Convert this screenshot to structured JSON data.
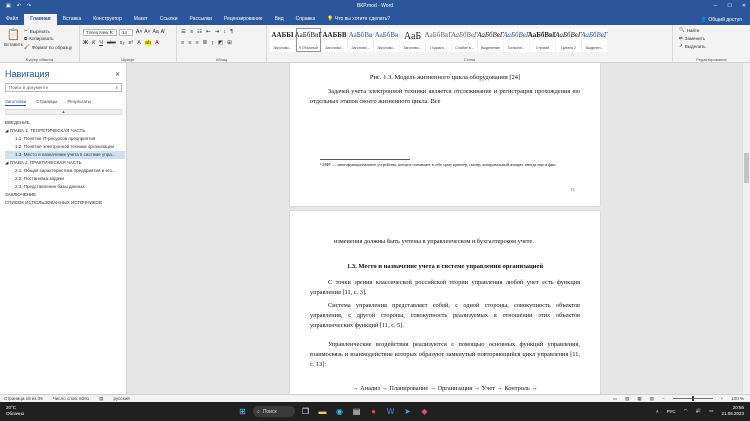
{
  "title_bar": {
    "doc_title": "ВКР.mod - Word",
    "search_hint": "Что вы хотите сделать?"
  },
  "tabs": [
    "Файл",
    "Главная",
    "Вставка",
    "Конструктор",
    "Макет",
    "Ссылки",
    "Рассылки",
    "Рецензирование",
    "Вид",
    "Справка"
  ],
  "share_label": "Общий доступ",
  "ribbon": {
    "paste": "Вставить",
    "cut": "Вырезать",
    "copy": "Копировать",
    "format_painter": "Формат по образцу",
    "clipboard_group": "Буфер обмена",
    "font_name": "Times New R",
    "font_size": "14",
    "font_group": "Шрифт",
    "paragraph_group": "Абзац",
    "styles_group": "Стили",
    "find": "Найти",
    "replace": "Заменить",
    "select": "Выделить",
    "editing_group": "Редактирование",
    "styles": [
      {
        "preview": "ААББІ",
        "name": "Заголово..."
      },
      {
        "preview": "АаБбВвГ",
        "name": "¶ Обычный"
      },
      {
        "preview": "ААББВ",
        "name": "Заголово..."
      },
      {
        "preview": "АаБбВв",
        "name": "Заголово..."
      },
      {
        "preview": "АаБбВв",
        "name": "Заголово..."
      },
      {
        "preview": "АаБ",
        "name": "Заголово..."
      },
      {
        "preview": "АаБбВвГ",
        "name": "Подзаго..."
      },
      {
        "preview": "АаБбВвГ",
        "name": "Слабое в..."
      },
      {
        "preview": "АаБбВвГ",
        "name": "Выделение"
      },
      {
        "preview": "АаБбВвГ",
        "name": "Сильное..."
      },
      {
        "preview": "АаБбВвГ",
        "name": "Строгий"
      },
      {
        "preview": "АаБбВвГ",
        "name": "Цитата 2"
      },
      {
        "preview": "АаБбВвГ",
        "name": "Выделен..."
      }
    ]
  },
  "nav": {
    "title": "Навигация",
    "search_placeholder": "Поиск в документе",
    "tabs": [
      "Заголовки",
      "Страницы",
      "Результаты"
    ],
    "items": [
      {
        "text": "ВВЕДЕНИЕ",
        "level": 1
      },
      {
        "text": "◢ ГЛАВА 1. ТЕОРЕТИЧЕСКАЯ ЧАСТЬ",
        "level": 1
      },
      {
        "text": "1.1. Понятие IT-ресурсов предприятия",
        "level": 2
      },
      {
        "text": "1.2. Понятие электронной техники организации",
        "level": 2
      },
      {
        "text": "1.3. Место и назначение учета в системе упра...",
        "level": 2,
        "selected": true
      },
      {
        "text": "◢ ГЛАВА 2. ПРАКТИЧЕСКАЯ ЧАСТЬ",
        "level": 1
      },
      {
        "text": "2.1. Общая характеристика предприятия и его...",
        "level": 2
      },
      {
        "text": "2.2. Постановка задачи",
        "level": 2
      },
      {
        "text": "2.3. Представление базы данных",
        "level": 2
      },
      {
        "text": "ЗАКЛЮЧЕНИЕ",
        "level": 1
      },
      {
        "text": "СПИСОК ИСПОЛЬЗОВАННЫХ ИСТОЧНИКОВ",
        "level": 1
      }
    ]
  },
  "page1": {
    "caption": "Рис. 1.3. Модель жизненного цикла оборудования [24]",
    "paragraph": "Задачей учета электронной техники является отслеживание и регистрация прохождения ею отдельных этапов своего жизненного цикла. Все",
    "footnote": "³ МФУ — многофункциональное устройство, которое совмещает в себе сразу принтер, сканер, копировальный аппарат, иногда еще и факс.",
    "page_number": "13"
  },
  "page2": {
    "line1": "изменения должны быть учтены в управленческом и бухгалтерском учете.",
    "heading": "1.3. Место и назначение учета в системе управления организацией",
    "p1": "С точки зрения классической российской теории управления любой учет есть функция управления [11, с. 3].",
    "p2": "Система управления представляет собой, с одной стороны, совокупность объектов управления, с другой стороны, совокупность реализуемых в отношении этих объектов управленческих функций [11, с. 5].",
    "p3": "Управленческие воздействия реализуются с помощью основных функций управления, взаимосвязь и взаимодействие которых образуют замкнутый повторяющийся цикл управления [11, с. 13]:",
    "flow": "→ Анализ → Планирование → Организация → Учет → Контроль →"
  },
  "status": {
    "page": "Страница 16 из 39",
    "words": "Число слов: 8291",
    "language": "русский",
    "zoom": "100 %"
  },
  "taskbar": {
    "temp": "20°C",
    "weather": "Облачно",
    "search": "Поиск",
    "lang": "РУС",
    "time": "20:56",
    "date": "21.05.2023"
  }
}
